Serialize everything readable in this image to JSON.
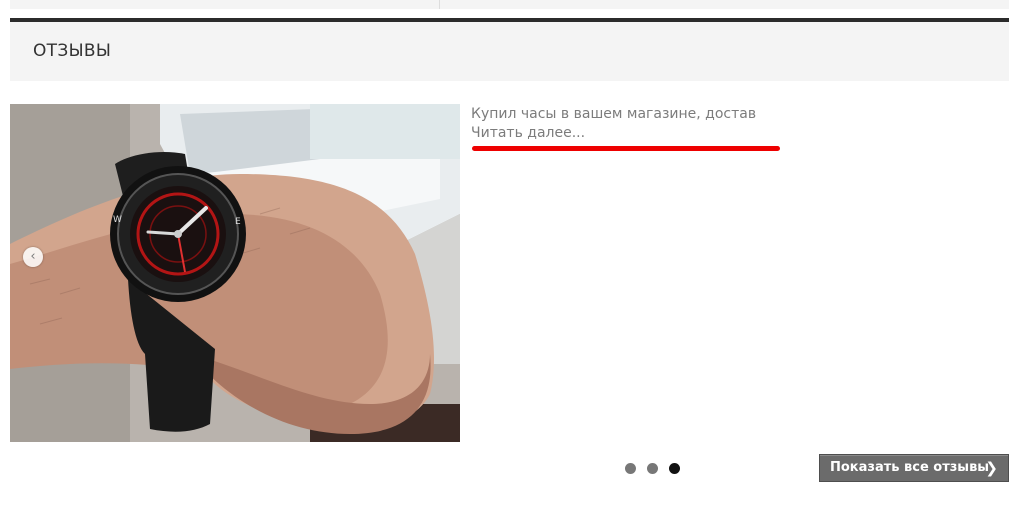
{
  "header": {
    "title": "ОТЗЫВЫ"
  },
  "review": {
    "text": "Купил часы в вашем магазине, достав",
    "read_more": "Читать далее...",
    "image_alt": "photo of a wristwatch on a hand"
  },
  "carousel": {
    "prev_icon": "chevron-left-icon",
    "prev_glyph": "‹",
    "pages": 3,
    "active_page": 3
  },
  "actions": {
    "show_all_label": "Показать все отзывы",
    "show_all_icon": "chevron-right-icon",
    "show_all_glyph": "❯"
  },
  "colors": {
    "accent_red": "#ee0000",
    "header_bar": "#2b2b2b",
    "button_bg": "#6b6b6b"
  }
}
